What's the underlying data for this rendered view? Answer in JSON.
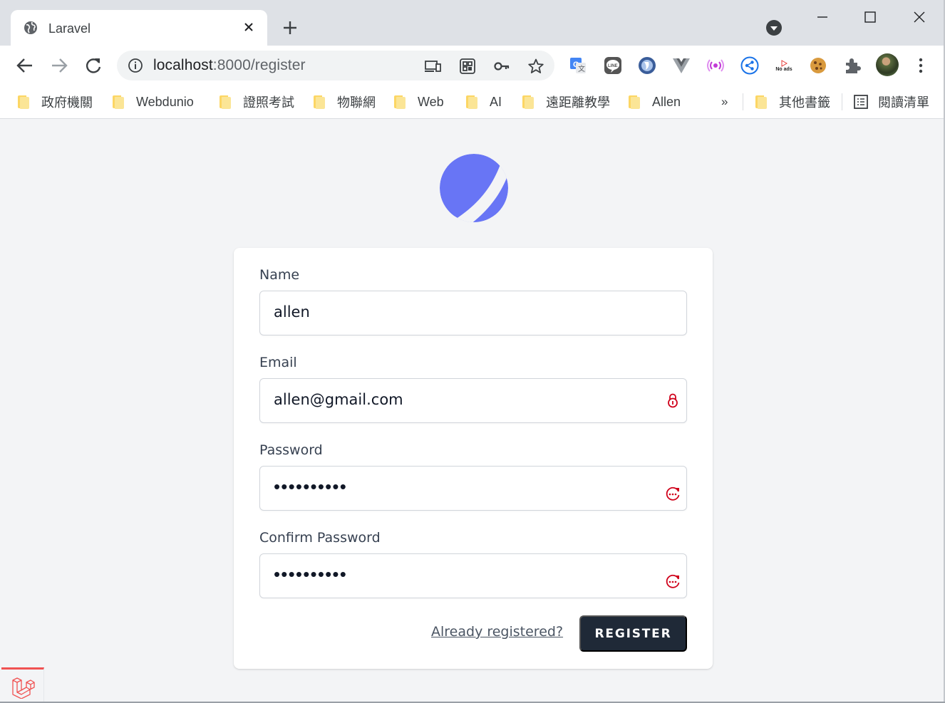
{
  "browser": {
    "tab_title": "Laravel",
    "url_host": "localhost",
    "url_path": ":8000/register",
    "extensions": [
      "translate-icon",
      "line-icon",
      "shield-ext-icon",
      "vue-devtools-icon",
      "broadcast-icon",
      "share-icon",
      "no-ads-icon",
      "cookie-icon",
      "puzzle-icon"
    ],
    "noads_label": "No ads"
  },
  "bookmarks": {
    "items": [
      "政府機關",
      "Webdunio",
      "證照考試",
      "物聯網",
      "Web",
      "AI",
      "遠距離教學",
      "Allen"
    ],
    "overflow": "»",
    "other": "其他書籤",
    "reading_list": "閱讀清單"
  },
  "form": {
    "name_label": "Name",
    "name_value": "allen",
    "email_label": "Email",
    "email_value": "allen@gmail.com",
    "password_label": "Password",
    "password_value": "••••••••••",
    "confirm_label": "Confirm Password",
    "confirm_value": "••••••••••",
    "login_link": "Already registered?",
    "submit_label": "REGISTER"
  },
  "colors": {
    "logo": "#6875f5",
    "button": "#1f2937",
    "password_manager": "#d0021b",
    "debugbar": "#f05252"
  }
}
